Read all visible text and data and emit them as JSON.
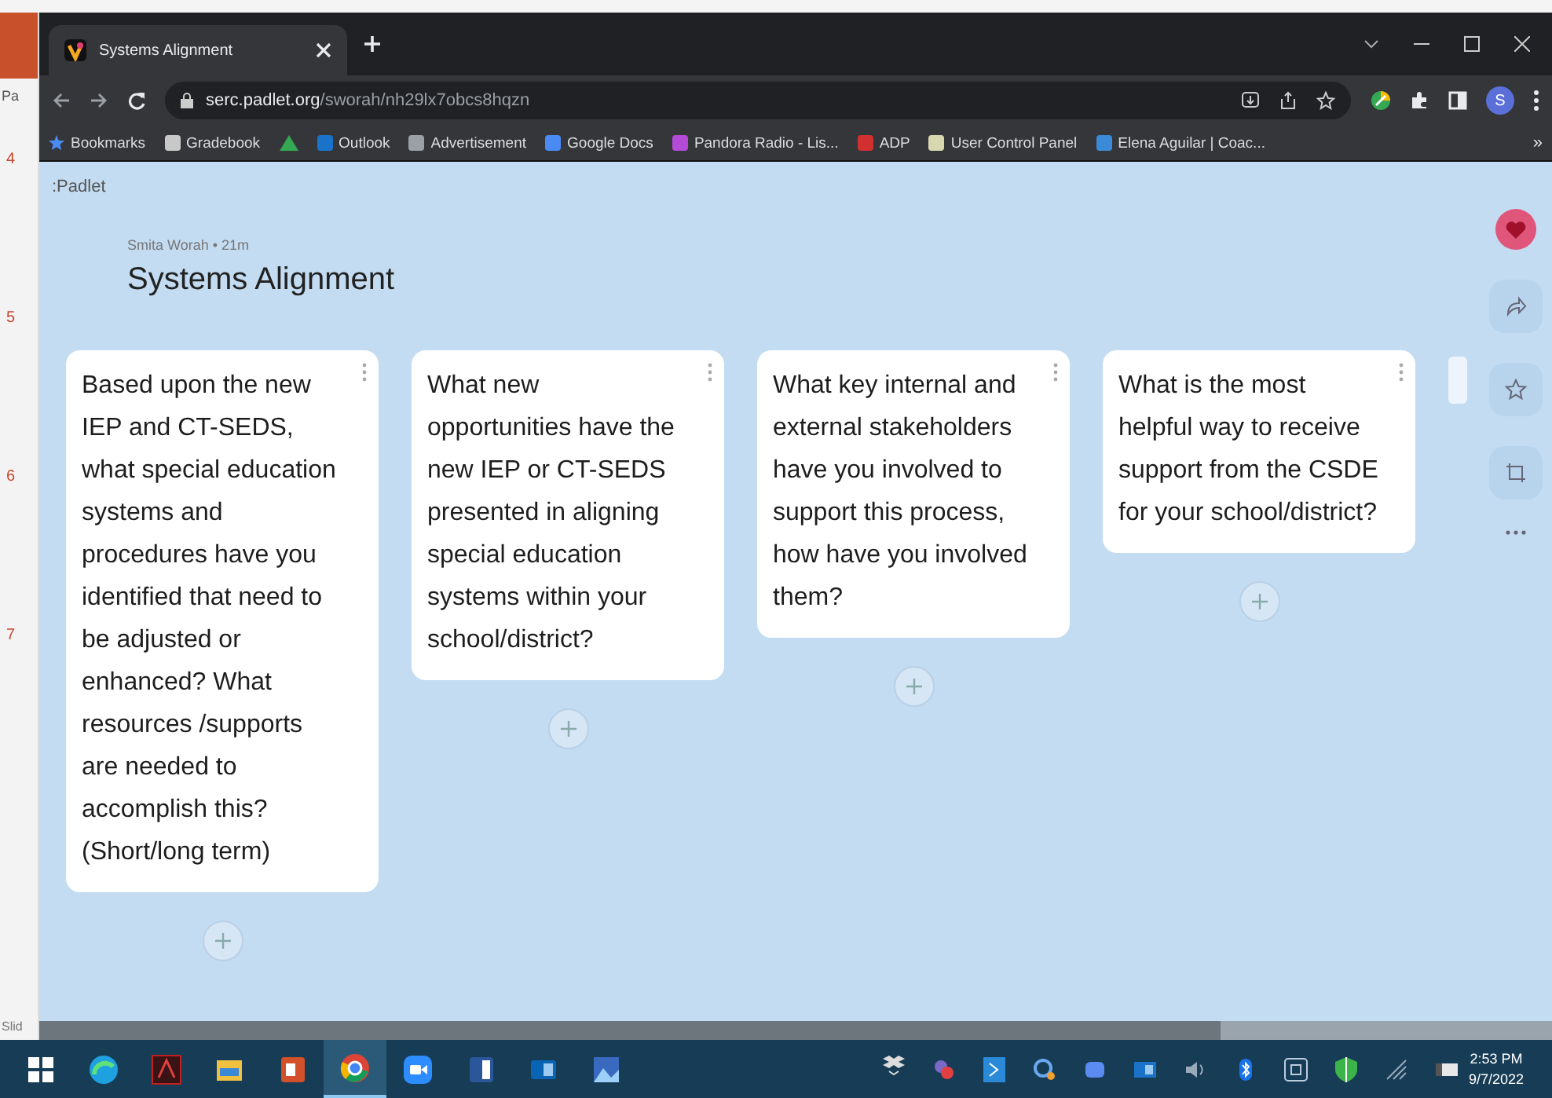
{
  "side_strip": {
    "header": "Pa",
    "slide_numbers": [
      "4",
      "5",
      "6",
      "7"
    ],
    "footer": "Slid"
  },
  "browser": {
    "tab_title": "Systems Alignment",
    "url_host": "serc.padlet.org",
    "url_path": "/sworah/nh29lx7obcs8hqzn",
    "profile_initial": "S",
    "bookmarks": [
      {
        "kind": "star",
        "label": "Bookmarks",
        "color": "#4a8af4"
      },
      {
        "kind": "site",
        "label": "Gradebook",
        "color": "#c8c8c8"
      },
      {
        "kind": "drive",
        "color": "#34a853"
      },
      {
        "kind": "site",
        "label": "Outlook",
        "color": "#1a73c8"
      },
      {
        "kind": "site",
        "label": "Advertisement",
        "color": "#9aa0a6"
      },
      {
        "kind": "site",
        "label": "Google Docs",
        "color": "#4a8af4"
      },
      {
        "kind": "site",
        "label": "Pandora Radio - Lis...",
        "color": "#b44ad8"
      },
      {
        "kind": "site",
        "label": "ADP",
        "color": "#d03030"
      },
      {
        "kind": "site",
        "label": "User Control Panel",
        "color": "#d8d8b0"
      },
      {
        "kind": "site",
        "label": "Elena Aguilar | Coac...",
        "color": "#3a8ad8"
      }
    ],
    "overflow": "»"
  },
  "padlet": {
    "logo": ":Padlet",
    "author": "Smita Worah • 21m",
    "title": "Systems Alignment",
    "columns": [
      {
        "question": "Based upon the new IEP and CT-SEDS, what special education systems and procedures have you identified that need to be adjusted or enhanced? What resources /supports are needed to accomplish this? (Short/long term)"
      },
      {
        "question": "What new opportunities have the new IEP or CT-SEDS presented in aligning special education systems within your school/district?"
      },
      {
        "question": "What key internal and external stakeholders have you involved to support this process, how have you involved them?"
      },
      {
        "question": "What is the most helpful way to receive support from the CSDE for your school/district?"
      }
    ]
  },
  "taskbar": {
    "apps": [
      {
        "kind": "windows",
        "selected": false
      },
      {
        "kind": "edge",
        "selected": false
      },
      {
        "kind": "acrobat",
        "selected": false
      },
      {
        "kind": "explorer",
        "selected": false
      },
      {
        "kind": "powerpoint",
        "selected": false
      },
      {
        "kind": "chrome",
        "selected": true
      },
      {
        "kind": "zoom",
        "selected": false
      },
      {
        "kind": "word",
        "selected": false
      },
      {
        "kind": "outlook",
        "selected": false
      },
      {
        "kind": "photos",
        "selected": false
      }
    ],
    "time": "2:53 PM",
    "date": "9/7/2022"
  }
}
